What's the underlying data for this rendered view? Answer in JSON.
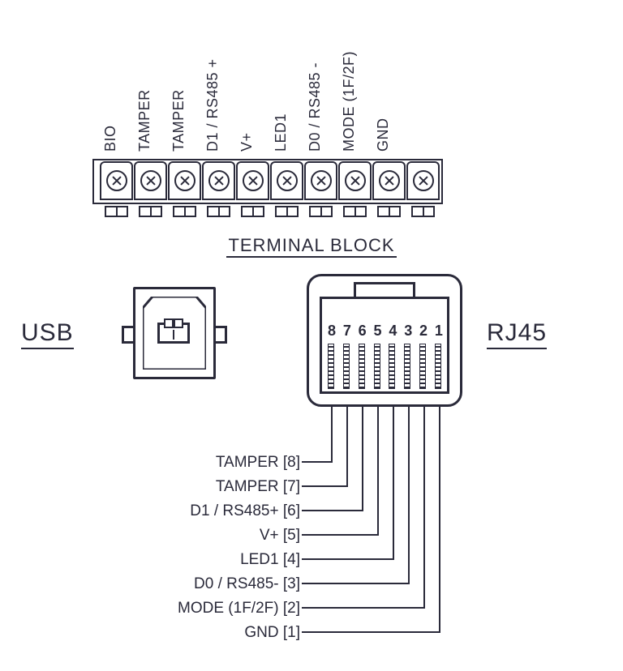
{
  "terminal_block": {
    "caption": "TERMINAL BLOCK",
    "pins": [
      "BIO",
      "TAMPER",
      "TAMPER",
      "D1 / RS485 +",
      "V+",
      "LED1",
      "D0 / RS485 -",
      "MODE (1F/2F)",
      "GND"
    ]
  },
  "usb": {
    "label": "USB"
  },
  "rj45": {
    "label": "RJ45",
    "pin_numbers": [
      "8",
      "7",
      "6",
      "5",
      "4",
      "3",
      "2",
      "1"
    ],
    "pinout": [
      {
        "pin": 8,
        "label": "TAMPER [8]"
      },
      {
        "pin": 7,
        "label": "TAMPER [7]"
      },
      {
        "pin": 6,
        "label": "D1 / RS485+ [6]"
      },
      {
        "pin": 5,
        "label": "V+ [5]"
      },
      {
        "pin": 4,
        "label": "LED1 [4]"
      },
      {
        "pin": 3,
        "label": "D0 / RS485- [3]"
      },
      {
        "pin": 2,
        "label": "MODE (1F/2F) [2]"
      },
      {
        "pin": 1,
        "label": "GND [1]"
      }
    ]
  }
}
